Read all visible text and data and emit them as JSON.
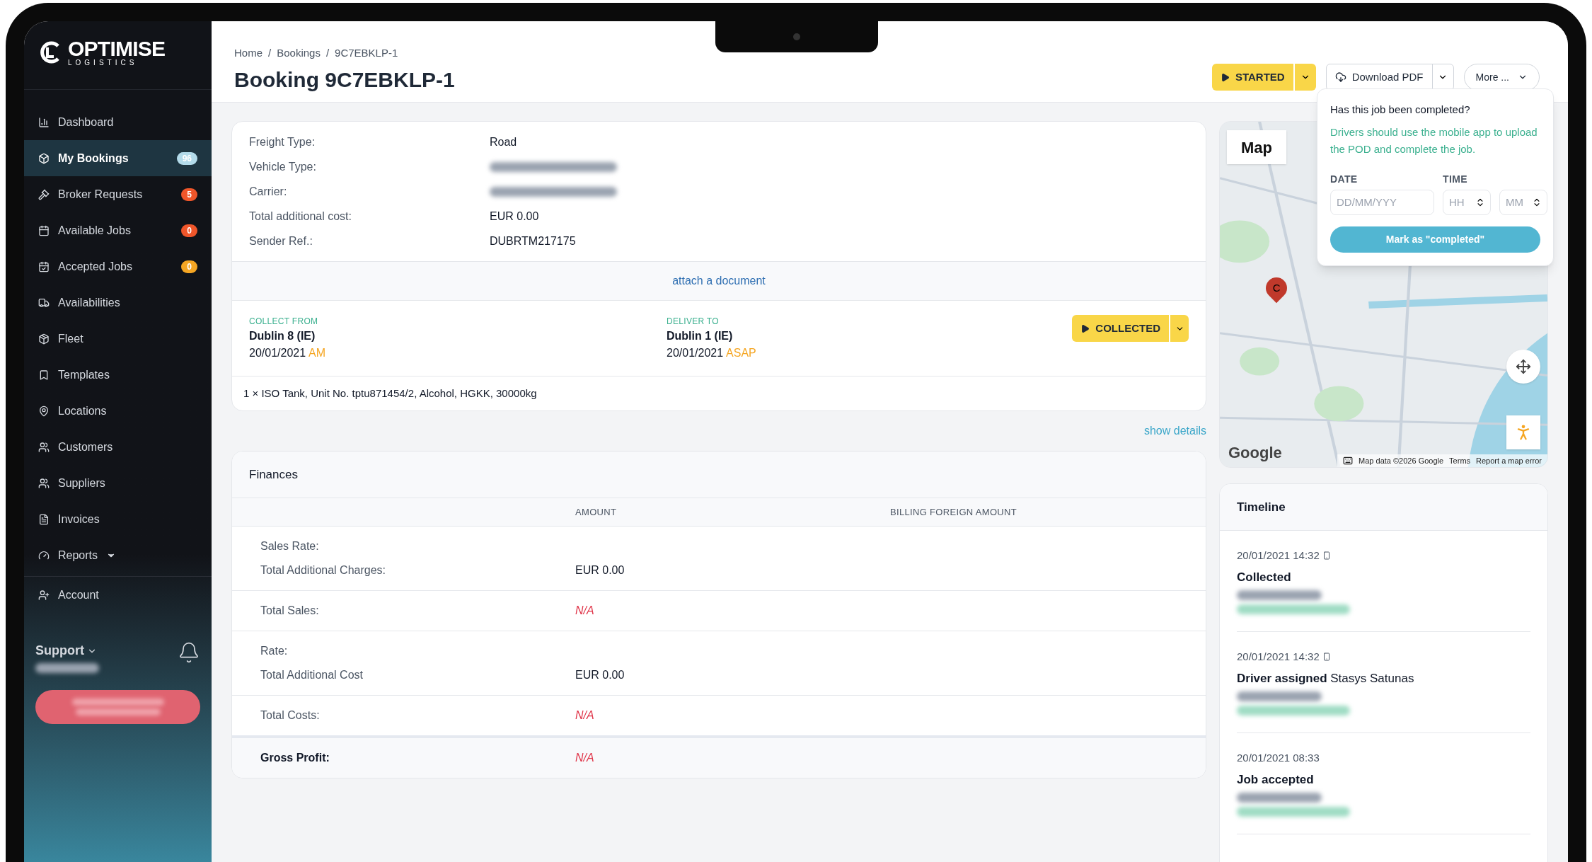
{
  "sidebar": {
    "logo": {
      "name": "OPTIMISE",
      "tagline": "LOGISTICS"
    },
    "items": [
      {
        "label": "Dashboard",
        "selected": false
      },
      {
        "label": "My Bookings",
        "selected": true,
        "badge": "96",
        "color": "#b3dbea"
      },
      {
        "label": "Broker Requests",
        "selected": false,
        "badge": "5",
        "color": "#f0562a"
      },
      {
        "label": "Available Jobs",
        "selected": false,
        "badge": "0",
        "color": "#f0562a"
      },
      {
        "label": "Accepted Jobs",
        "selected": false,
        "badge": "0",
        "color": "#f5a623"
      },
      {
        "label": "Availabilities",
        "selected": false
      },
      {
        "label": "Fleet",
        "selected": false
      },
      {
        "label": "Templates",
        "selected": false
      },
      {
        "label": "Locations",
        "selected": false
      },
      {
        "label": "Customers",
        "selected": false
      },
      {
        "label": "Suppliers",
        "selected": false
      },
      {
        "label": "Invoices",
        "selected": false
      },
      {
        "label": "Reports",
        "selected": false,
        "expandable": true
      },
      {
        "label": "Account",
        "selected": false
      }
    ],
    "user": {
      "name": "Support"
    }
  },
  "breadcrumbs": [
    "Home",
    "Bookings",
    "9C7EBKLP-1"
  ],
  "breadcrumb_separator": "/",
  "title": "Booking 9C7EBKLP-1",
  "actions": {
    "status": "STARTED",
    "download": "Download PDF",
    "more": "More ..."
  },
  "details": {
    "fields": [
      {
        "label": "Freight Type:",
        "value": "Road"
      },
      {
        "label": "Vehicle Type:"
      },
      {
        "label": "Carrier:"
      },
      {
        "label": "Total additional cost:",
        "value": "EUR 0.00"
      },
      {
        "label": "Sender Ref.:",
        "value": "DUBRTM217175"
      }
    ],
    "attach_link": "attach a document",
    "collect": {
      "heading": "COLLECT FROM",
      "place": "Dublin 8 (IE)",
      "date": "20/01/2021",
      "slot": "AM"
    },
    "deliver": {
      "heading": "DELIVER TO",
      "place": "Dublin 1 (IE)",
      "date": "20/01/2021",
      "slot": "ASAP"
    },
    "leg_status": "COLLECTED",
    "cargo": "1 × ISO Tank, Unit No. tptu871454/2, Alcohol, HGKK, 30000kg"
  },
  "show_details": "show details",
  "finances": {
    "title": "Finances",
    "columns": [
      "AMOUNT",
      "BILLING FOREIGN AMOUNT"
    ],
    "rows": [
      {
        "labels": [
          "Sales Rate:",
          "Total Additional Charges:"
        ],
        "amount": "EUR 0.00",
        "missing": false,
        "total": false
      },
      {
        "labels": [
          "Total Sales:"
        ],
        "amount": "N/A",
        "missing": true,
        "total": false
      },
      {
        "labels": [
          "Rate:",
          "Total Additional Cost"
        ],
        "amount": "EUR 0.00",
        "missing": false,
        "total": false
      },
      {
        "labels": [
          "Total Costs:"
        ],
        "amount": "N/A",
        "missing": true,
        "total": false
      },
      {
        "labels": [
          "Gross Profit:"
        ],
        "amount": "N/A",
        "missing": true,
        "total": true
      }
    ]
  },
  "map": {
    "tab": "Map",
    "marker": "C",
    "attribution": "Map data ©2026 Google",
    "terms": "Terms",
    "report": "Report a map error",
    "logo": "Google"
  },
  "completion_popover": {
    "question": "Has this job been completed?",
    "hint": "Drivers should use the mobile app to upload the POD and complete the job.",
    "date_label": "DATE",
    "time_label": "TIME",
    "date_placeholder": "DD/MM/YYY",
    "hour_placeholder": "HH",
    "minute_placeholder": "MM",
    "button": "Mark as \"completed\""
  },
  "timeline": {
    "title": "Timeline",
    "entries": [
      {
        "time": "20/01/2021 14:32",
        "via_mobile": true,
        "text": "**Collected**"
      },
      {
        "time": "20/01/2021 14:32",
        "via_mobile": true,
        "text": "**Driver assigned** Stasys Satunas"
      },
      {
        "time": "20/01/2021 08:33",
        "via_mobile": false,
        "text": "**Job accepted**"
      }
    ]
  }
}
